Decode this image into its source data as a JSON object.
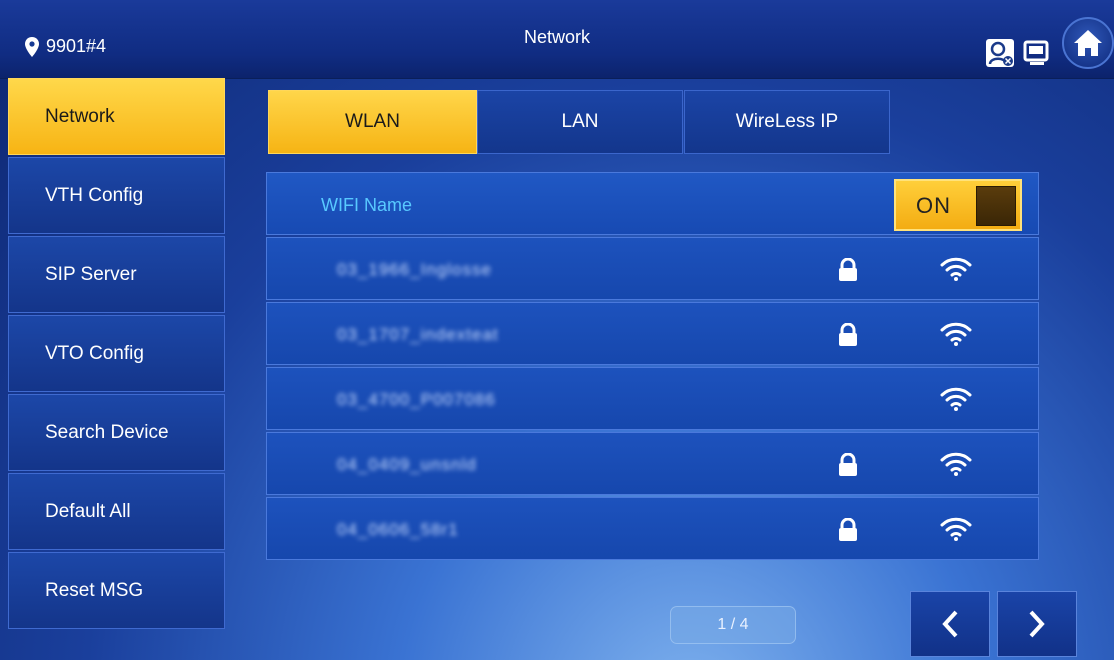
{
  "header": {
    "location": "9901#4",
    "title": "Network",
    "icons": [
      "location-pin-icon",
      "network-status-icon",
      "monitor-icon",
      "home-icon"
    ]
  },
  "sidebar": {
    "items": [
      {
        "label": "Network",
        "active": true
      },
      {
        "label": "VTH Config",
        "active": false
      },
      {
        "label": "SIP Server",
        "active": false
      },
      {
        "label": "VTO Config",
        "active": false
      },
      {
        "label": "Search Device",
        "active": false
      },
      {
        "label": "Default All",
        "active": false
      },
      {
        "label": "Reset MSG",
        "active": false
      }
    ]
  },
  "tabs": [
    {
      "label": "WLAN",
      "active": true
    },
    {
      "label": "LAN",
      "active": false
    },
    {
      "label": "WireLess IP",
      "active": false
    }
  ],
  "wifi": {
    "header_label": "WIFI Name",
    "toggle_label": "ON",
    "networks": [
      {
        "ssid": "03_1966_Inglosse",
        "locked": true
      },
      {
        "ssid": "03_1707_indexteat",
        "locked": true
      },
      {
        "ssid": "03_4700_P007086",
        "locked": false
      },
      {
        "ssid": "04_0409_unsnld",
        "locked": true
      },
      {
        "ssid": "04_0606_58r1",
        "locked": true
      }
    ]
  },
  "pagination": {
    "label": "1 / 4"
  },
  "colors": {
    "accent": "#f7b414",
    "wifi_label": "#58c9ff"
  }
}
